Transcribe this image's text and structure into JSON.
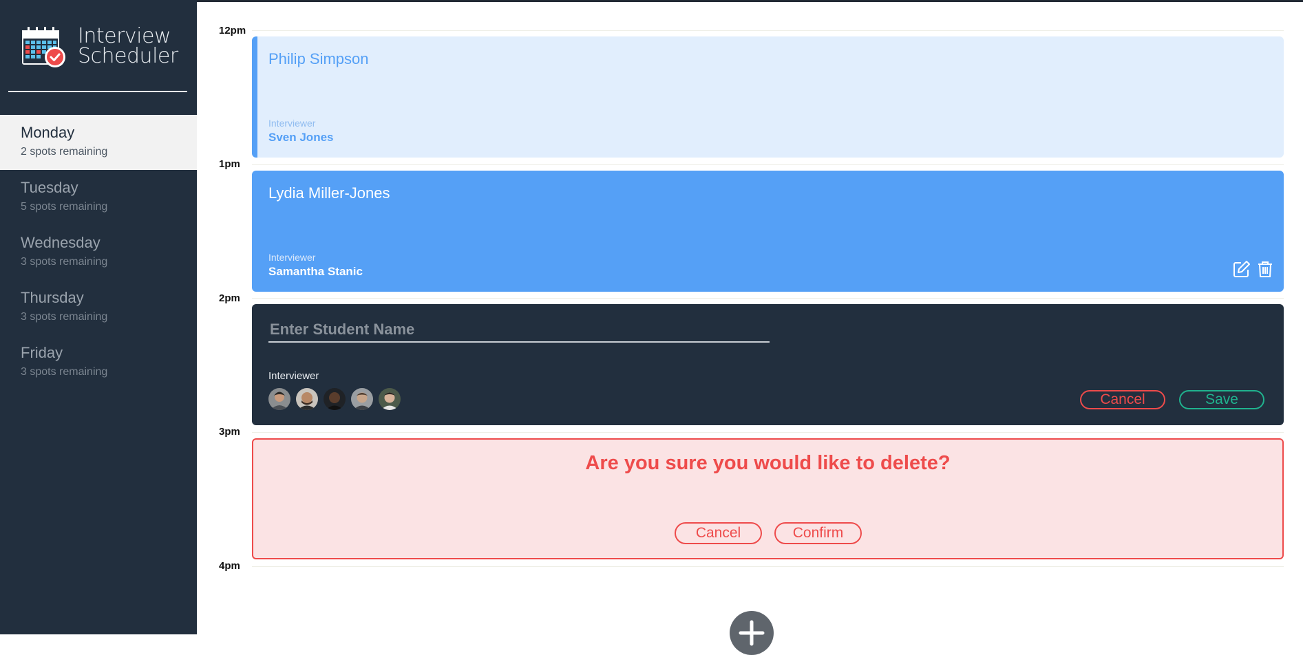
{
  "app": {
    "title_line1": "Interview",
    "title_line2": "Scheduler"
  },
  "days": [
    {
      "name": "Monday",
      "spots": "2 spots remaining",
      "selected": true
    },
    {
      "name": "Tuesday",
      "spots": "5 spots remaining",
      "selected": false
    },
    {
      "name": "Wednesday",
      "spots": "3 spots remaining",
      "selected": false
    },
    {
      "name": "Thursday",
      "spots": "3 spots remaining",
      "selected": false
    },
    {
      "name": "Friday",
      "spots": "3 spots remaining",
      "selected": false
    }
  ],
  "times": [
    "12pm",
    "1pm",
    "2pm",
    "3pm",
    "4pm"
  ],
  "appointments": {
    "first": {
      "student": "Philip Simpson",
      "interviewer_label": "Interviewer",
      "interviewer": "Sven Jones"
    },
    "second": {
      "student": "Lydia Miller-Jones",
      "interviewer_label": "Interviewer",
      "interviewer": "Samantha Stanic",
      "actions": [
        "edit-icon",
        "trash-icon"
      ]
    },
    "form": {
      "placeholder": "Enter Student Name",
      "value": "",
      "interviewer_label": "Interviewer",
      "interviewers": [
        "interviewer-avatar-1",
        "interviewer-avatar-2",
        "interviewer-avatar-3",
        "interviewer-avatar-4",
        "interviewer-avatar-5"
      ],
      "cancel_label": "Cancel",
      "save_label": "Save"
    },
    "confirm": {
      "message": "Are you sure you would like to delete?",
      "cancel_label": "Cancel",
      "confirm_label": "Confirm"
    }
  },
  "add_button_icon": "plus-icon",
  "colors": {
    "sidebar_bg": "#222f3e",
    "accent_blue": "#55a0f6",
    "danger": "#ee4b4b",
    "success": "#20b28e",
    "selected_day_bg": "#f2f2f2"
  }
}
